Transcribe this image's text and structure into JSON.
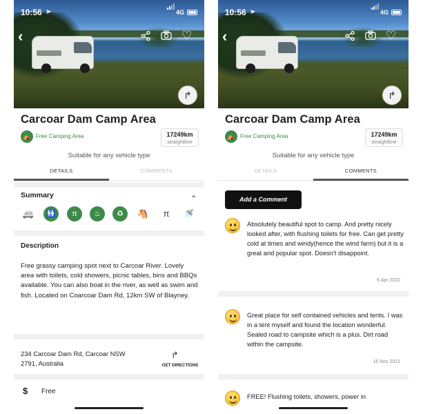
{
  "status_bar": {
    "time": "10:56",
    "network": "4G"
  },
  "campsite": {
    "name": "Carcoar Dam Camp Area",
    "type": "Free Camping Area",
    "distance": "17249km",
    "distance_note": "straightline",
    "suitability": "Suitable for any vehicle type"
  },
  "tabs": [
    {
      "label": "DETAILS"
    },
    {
      "label": "COMMENTS"
    }
  ],
  "details": {
    "summary_heading": "Summary",
    "amenities": [
      {
        "icon": "motorhome-icon"
      },
      {
        "icon": "toilets-icon"
      },
      {
        "icon": "picnic-table-icon"
      },
      {
        "icon": "bbq-icon"
      },
      {
        "icon": "bin-icon"
      },
      {
        "icon": "pets-icon"
      },
      {
        "icon": "picnic-icon"
      },
      {
        "icon": "shower-icon"
      }
    ],
    "description_heading": "Description",
    "description": "Free grassy camping spot next to Carcoar River. Lovely area with toilets, cold showers, picnic tables, bins and BBQs available. You can also boat in the river, as well as swim and fish. Located on Coarcoar Dam Rd, 12km SW of Blayney.",
    "address_line1": "234 Carcoar Dam Rd, Carcoar NSW",
    "address_line2": "2791, Australia",
    "directions_label": "GET DIRECTIONS",
    "price": "Free"
  },
  "comments_tab": {
    "add_comment_label": "Add a Comment",
    "comments": [
      {
        "text": "Absolutely beautiful spot to camp. And pretty nicely looked after, with flushing toilets for free. Can get pretty cold at times and windy(hence the wind farm) but it is a great and popular spot. Doesn't disappoint.",
        "date": "6 Apr 2022"
      },
      {
        "text": "Great place for self contained vehicles and tents. I was in a tent myself and found the location wonderful. Sealed road to campsite which is a plus. Dirt road within the campsite.",
        "date": "16 Nov 2021"
      },
      {
        "text": "FREE! Flushing toilets, showers, power in",
        "date": ""
      }
    ]
  }
}
